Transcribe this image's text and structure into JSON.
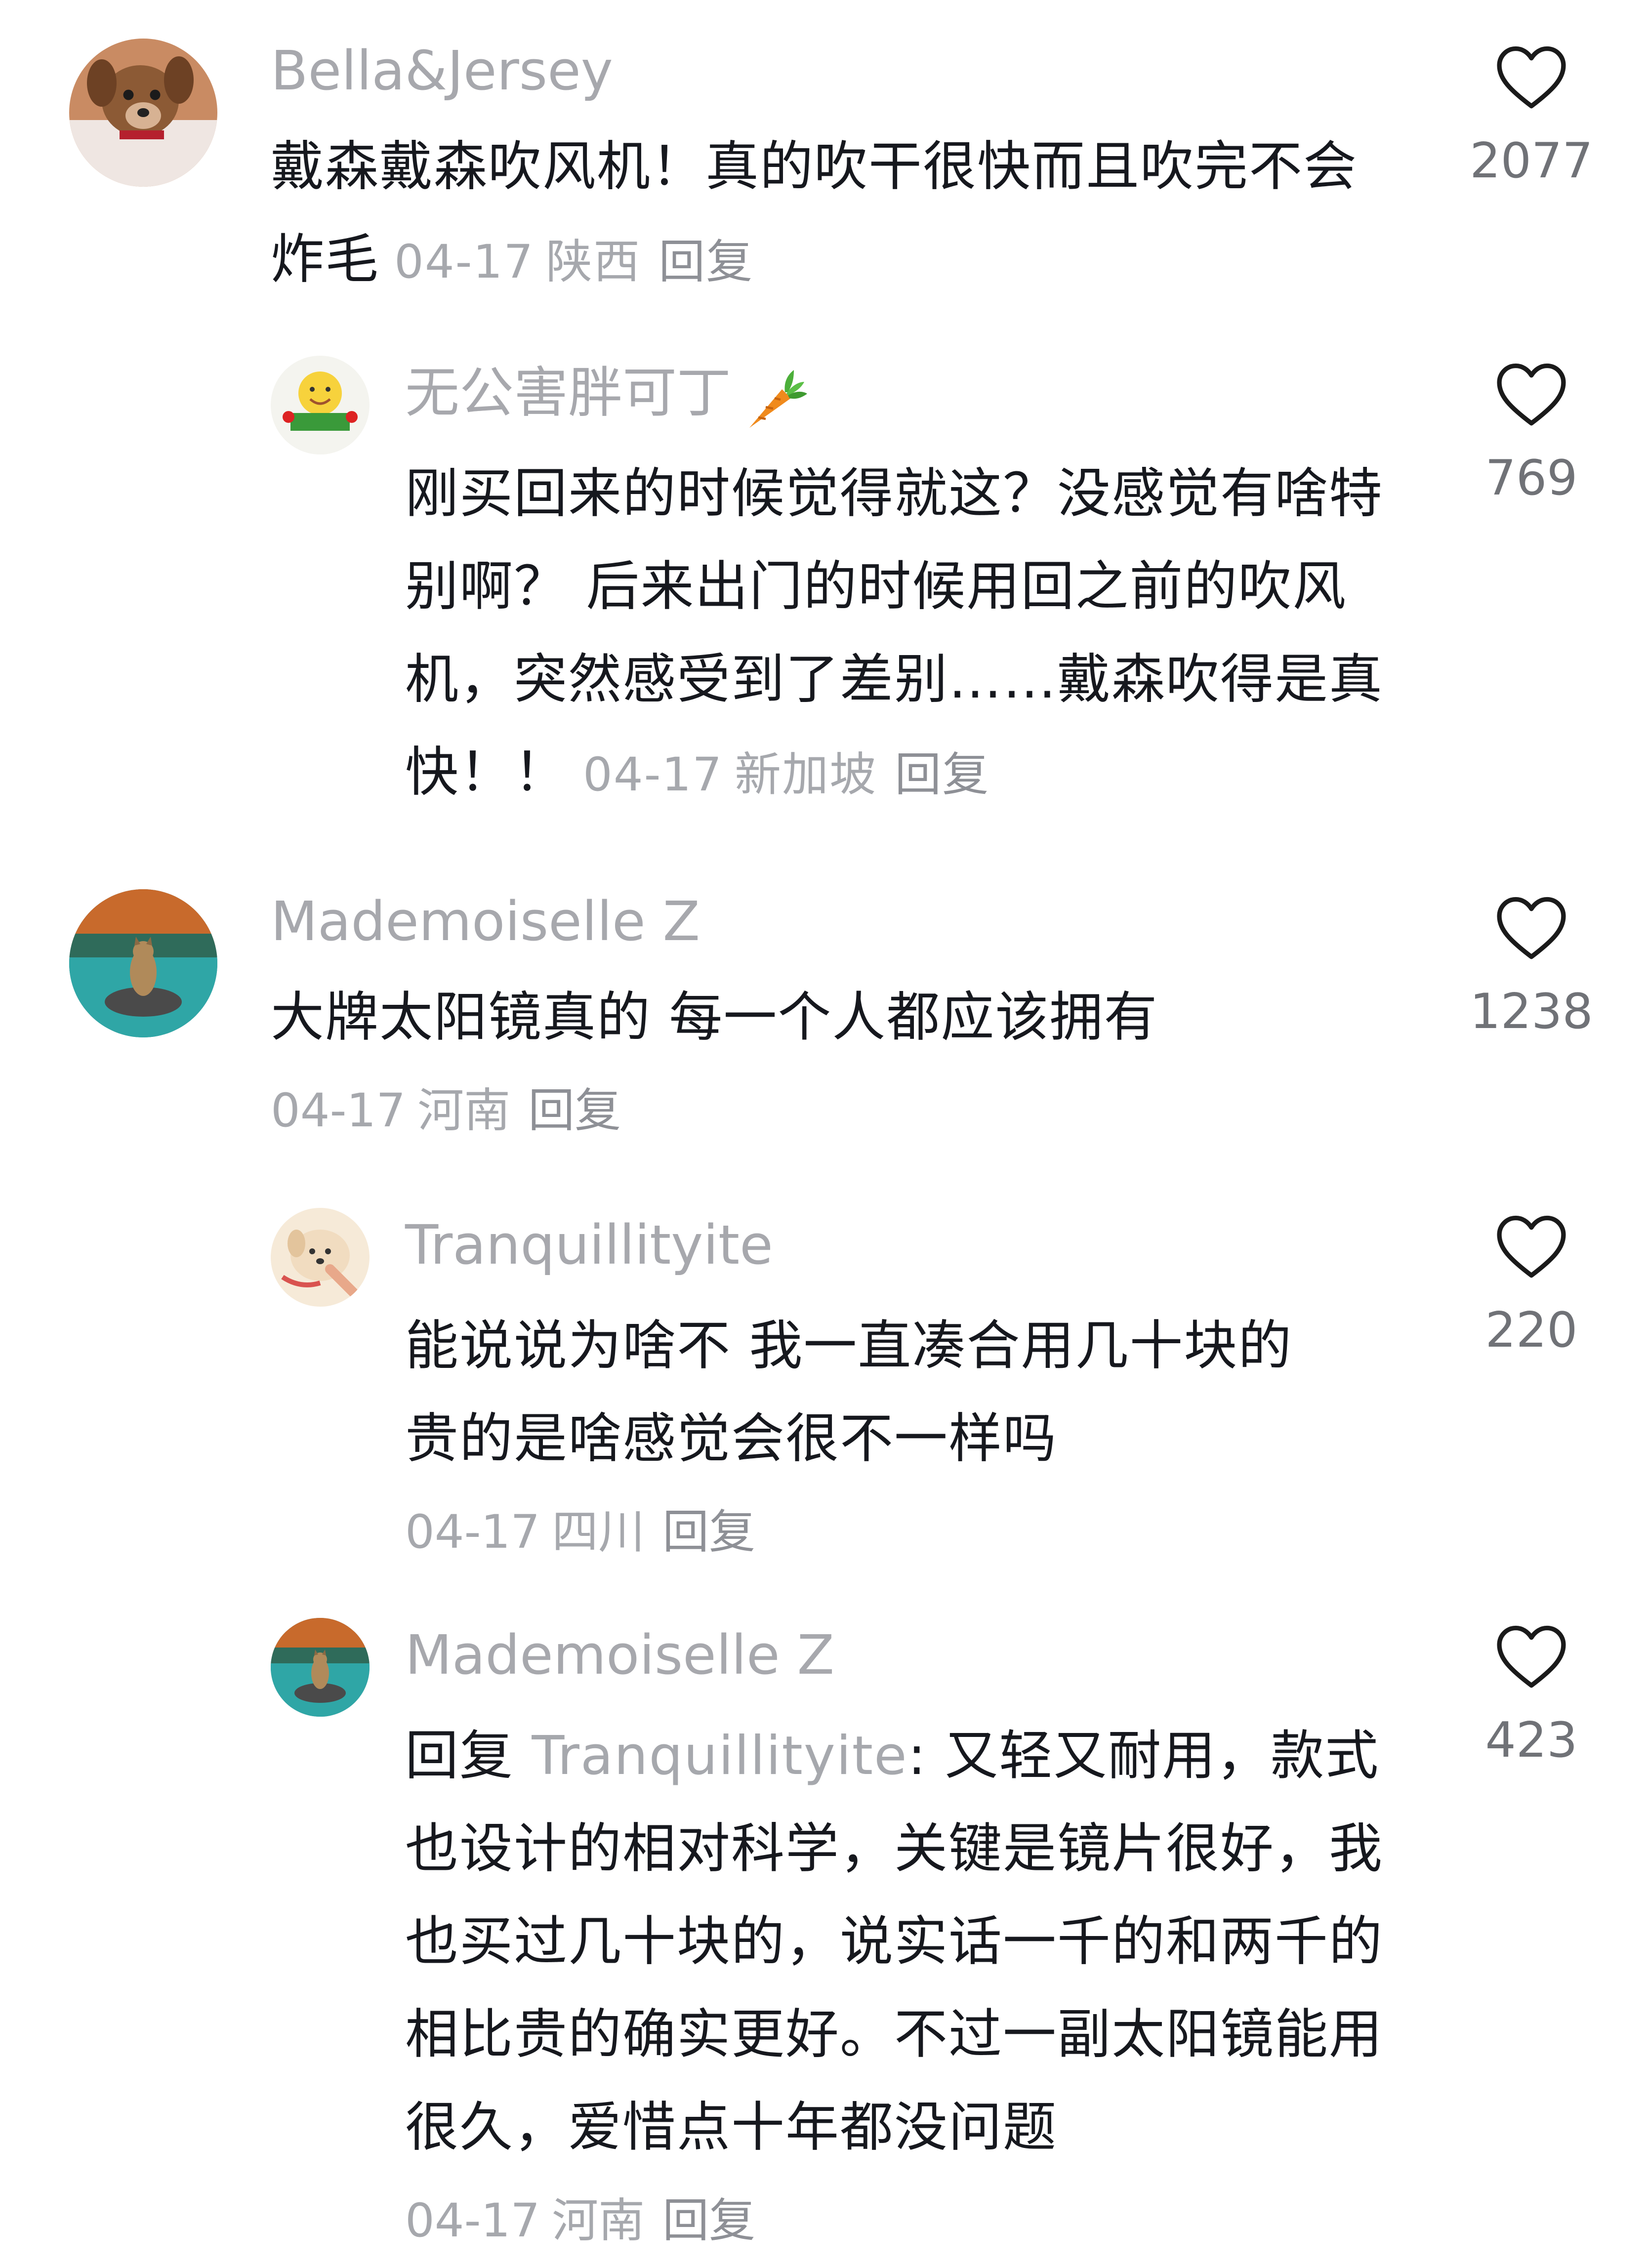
{
  "comments": [
    {
      "username": "Bella&Jersey",
      "text": "戴森戴森吹风机！真的吹干很快而且吹完不会炸毛",
      "date": "04-17",
      "region": "陕西",
      "reply_label": "回复",
      "likes": "2077",
      "avatar_icon": "dog-photo-avatar-icon"
    },
    {
      "username": "无公害胖可丁",
      "username_emoji": "carrot-icon",
      "text": "刚买回来的时候觉得就这？没感觉有啥特别啊？ 后来出门的时候用回之前的吹风机，突然感受到了差别……戴森吹得是真快！！",
      "date": "04-17",
      "region": "新加坡",
      "reply_label": "回复",
      "likes": "769",
      "avatar_icon": "smiley-sticker-avatar-icon"
    },
    {
      "username": "Mademoiselle Z",
      "text": "大牌太阳镜真的 每一个人都应该拥有",
      "date": "04-17",
      "region": "河南",
      "reply_label": "回复",
      "likes": "1238",
      "avatar_icon": "cat-on-rock-avatar-icon"
    },
    {
      "username": "Tranquillityite",
      "text": "能说说为啥不 我一直凑合用几十块的 贵的是啥感觉会很不一样吗",
      "date": "04-17",
      "region": "四川",
      "reply_label": "回复",
      "likes": "220",
      "avatar_icon": "cartoon-dog-avatar-icon"
    },
    {
      "username": "Mademoiselle Z",
      "reply_prefix": "回复 ",
      "mention": "Tranquillityite",
      "mention_sep": ": ",
      "text": "又轻又耐用，款式也设计的相对科学，关键是镜片很好，我也买过几十块的，说实话一千的和两千的相比贵的确实更好。不过一副太阳镜能用很久，爱惜点十年都没问题",
      "date": "04-17",
      "region": "河南",
      "reply_label": "回复",
      "likes": "423",
      "avatar_icon": "cat-on-rock-avatar-icon"
    }
  ],
  "colors": {
    "username": "#a7a8ad",
    "text": "#16181e",
    "meta": "#a6a8ad",
    "like_count": "#707277",
    "heart_outline": "#1a1a1a"
  }
}
